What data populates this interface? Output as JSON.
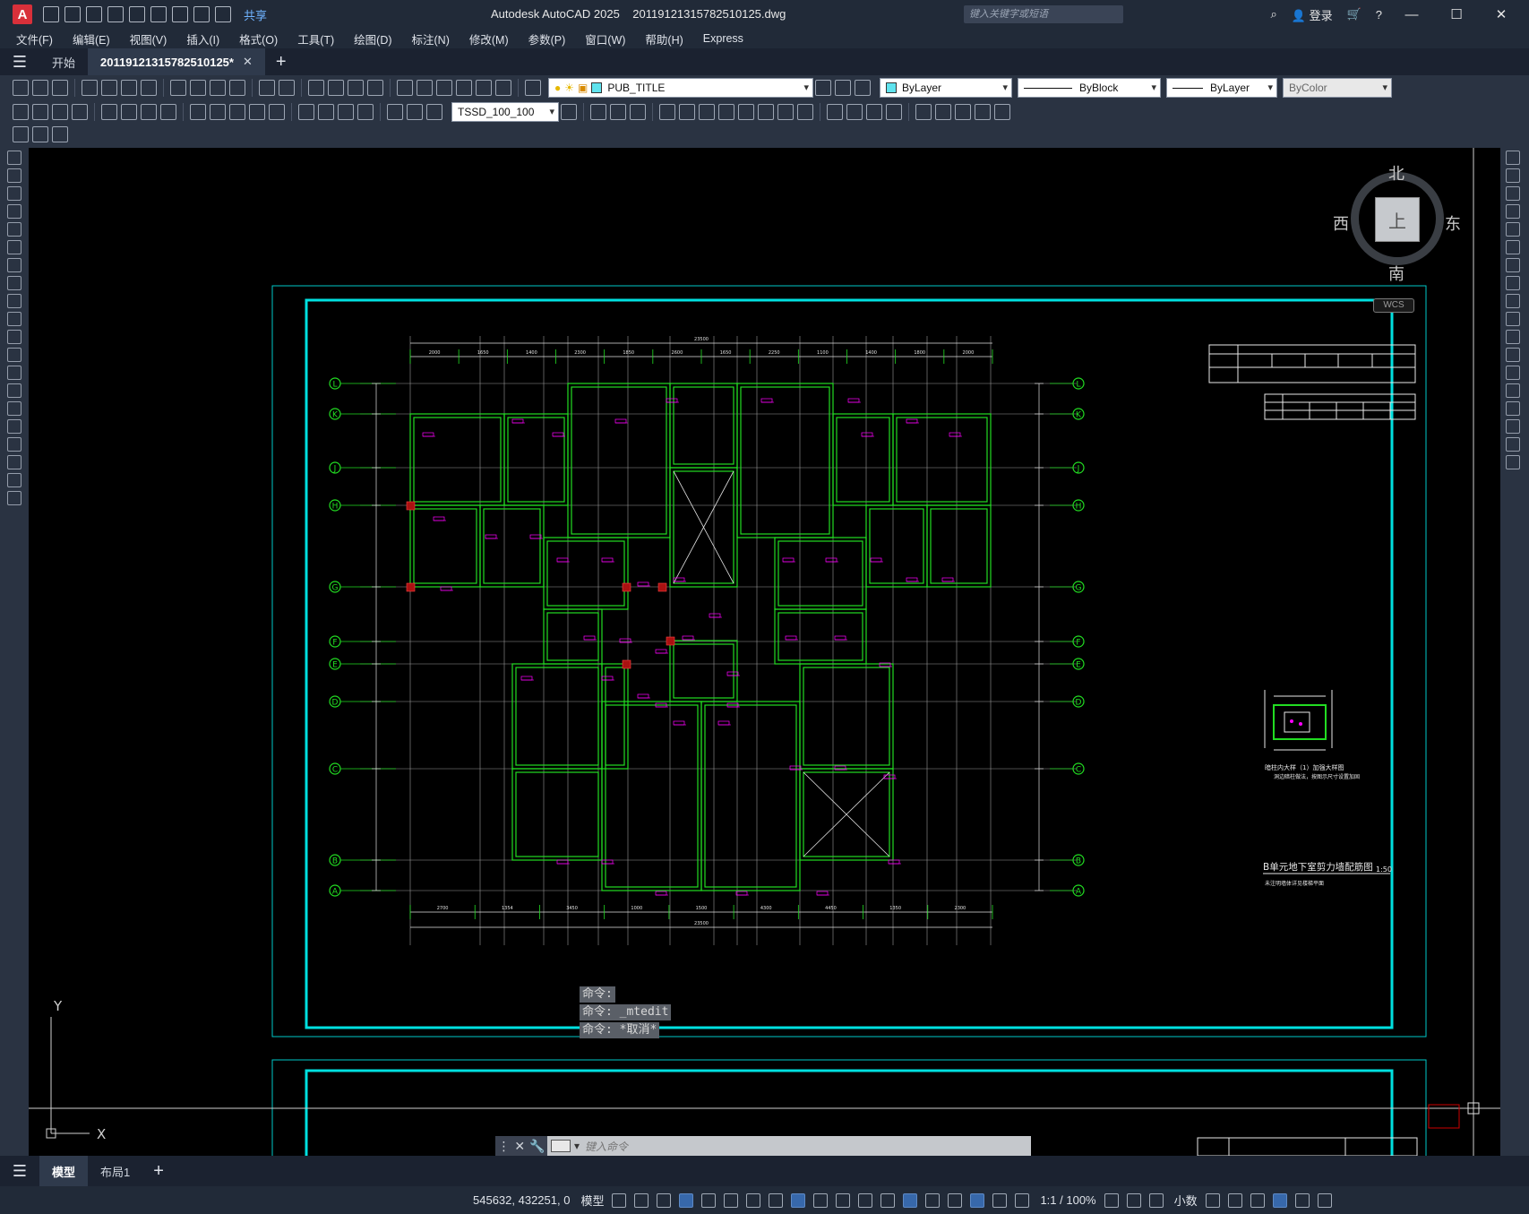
{
  "app": {
    "logo": "A",
    "share": "共享",
    "title": "Autodesk AutoCAD 2025",
    "file": "20119121315782510125.dwg",
    "search_placeholder": "键入关键字或短语",
    "login": "登录"
  },
  "menu": [
    "文件(F)",
    "编辑(E)",
    "视图(V)",
    "插入(I)",
    "格式(O)",
    "工具(T)",
    "绘图(D)",
    "标注(N)",
    "修改(M)",
    "参数(P)",
    "窗口(W)",
    "帮助(H)",
    "Express"
  ],
  "tabs": {
    "start": "开始",
    "doc": "20119121315782510125*",
    "close": "✕",
    "plus": "+"
  },
  "toolbar": {
    "layer": "PUB_TITLE",
    "color": "ByLayer",
    "linetype": "ByBlock",
    "lineweight": "ByLayer",
    "plotstyle": "ByColor",
    "dimstyle": "TSSD_100_100"
  },
  "viewcube": {
    "north": "北",
    "south": "南",
    "east": "东",
    "west": "西",
    "face": "上",
    "wcs": "WCS"
  },
  "drawing": {
    "row_axes": [
      "L",
      "K",
      "J",
      "H",
      "G",
      "F",
      "E",
      "D",
      "C",
      "B",
      "A"
    ],
    "top_dims": [
      "2000",
      "1650",
      "1400",
      "2300",
      "1850",
      "2600",
      "1650",
      "2250",
      "1100",
      "1400",
      "1800",
      "2000"
    ],
    "top_total": "23500",
    "bottom_dims": [
      "2700",
      "1354",
      "3450",
      "1000",
      "1500",
      "4300",
      "4450",
      "1350",
      "2300"
    ],
    "bottom_total": "23500",
    "title": "B单元地下室剪力墙配筋图",
    "scale": "1:50",
    "note": "未注明墙体详见楼梯平面",
    "detail_title": "暗柱内大样（1）加强大样图",
    "detail_note": "洞边暗柱做法，按图示尺寸设置加固"
  },
  "ucs": {
    "y": "Y",
    "x": "X"
  },
  "command": {
    "history": [
      "命令:",
      "命令: _mtedit",
      "命令: *取消*"
    ],
    "placeholder": "键入命令"
  },
  "layouts": [
    "模型",
    "布局1"
  ],
  "status": {
    "coords": "545632, 432251, 0",
    "space": "模型",
    "scale": "1:1 / 100%",
    "units": "小数"
  },
  "colors": {
    "wall": "#22dd22",
    "frame": "#00d8d8",
    "annotation": "#ff00ff",
    "axis": "#22dd22"
  }
}
